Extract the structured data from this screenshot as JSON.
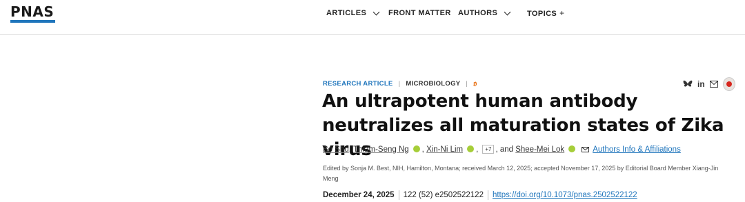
{
  "header": {
    "logo": "PNAS",
    "nav": [
      {
        "label": "ARTICLES",
        "control": "chevron-down"
      },
      {
        "label": "FRONT MATTER",
        "control": ""
      },
      {
        "label": "AUTHORS",
        "control": "chevron-down"
      },
      {
        "label": "TOPICS",
        "control": "+"
      }
    ]
  },
  "article": {
    "type": "RESEARCH ARTICLE",
    "subject": "MICROBIOLOGY",
    "open_access_icon": "open-access-icon",
    "title": "An ultrapotent human antibody neutralizes all maturation states of Zika virus",
    "authors": [
      "Bo Shu",
      "Thiam-Seng Ng",
      "Xin-Ni Lim",
      "Shee-Mei Lok"
    ],
    "more_authors": "+7",
    "and_text": ", and",
    "affiliations_link": "Authors Info & Affiliations",
    "edited_by": "Edited by Sonja M. Best, NIH, Hamilton, Montana; received March 12, 2025; accepted November 17, 2025 by Editorial Board Member Xiang-Jin Meng",
    "date": "December 24, 2025",
    "citation": "122 (52) e2502522122",
    "doi": "https://doi.org/10.1073/pnas.2502522122"
  },
  "share": {
    "icons": [
      "bluesky-icon",
      "linkedin-icon",
      "mail-icon",
      "altmetric-icon"
    ],
    "linkedin_text": "in"
  },
  "colors": {
    "accent": "#1f75bc",
    "orcid": "#a6ce39",
    "open_access": "#e8741a"
  }
}
